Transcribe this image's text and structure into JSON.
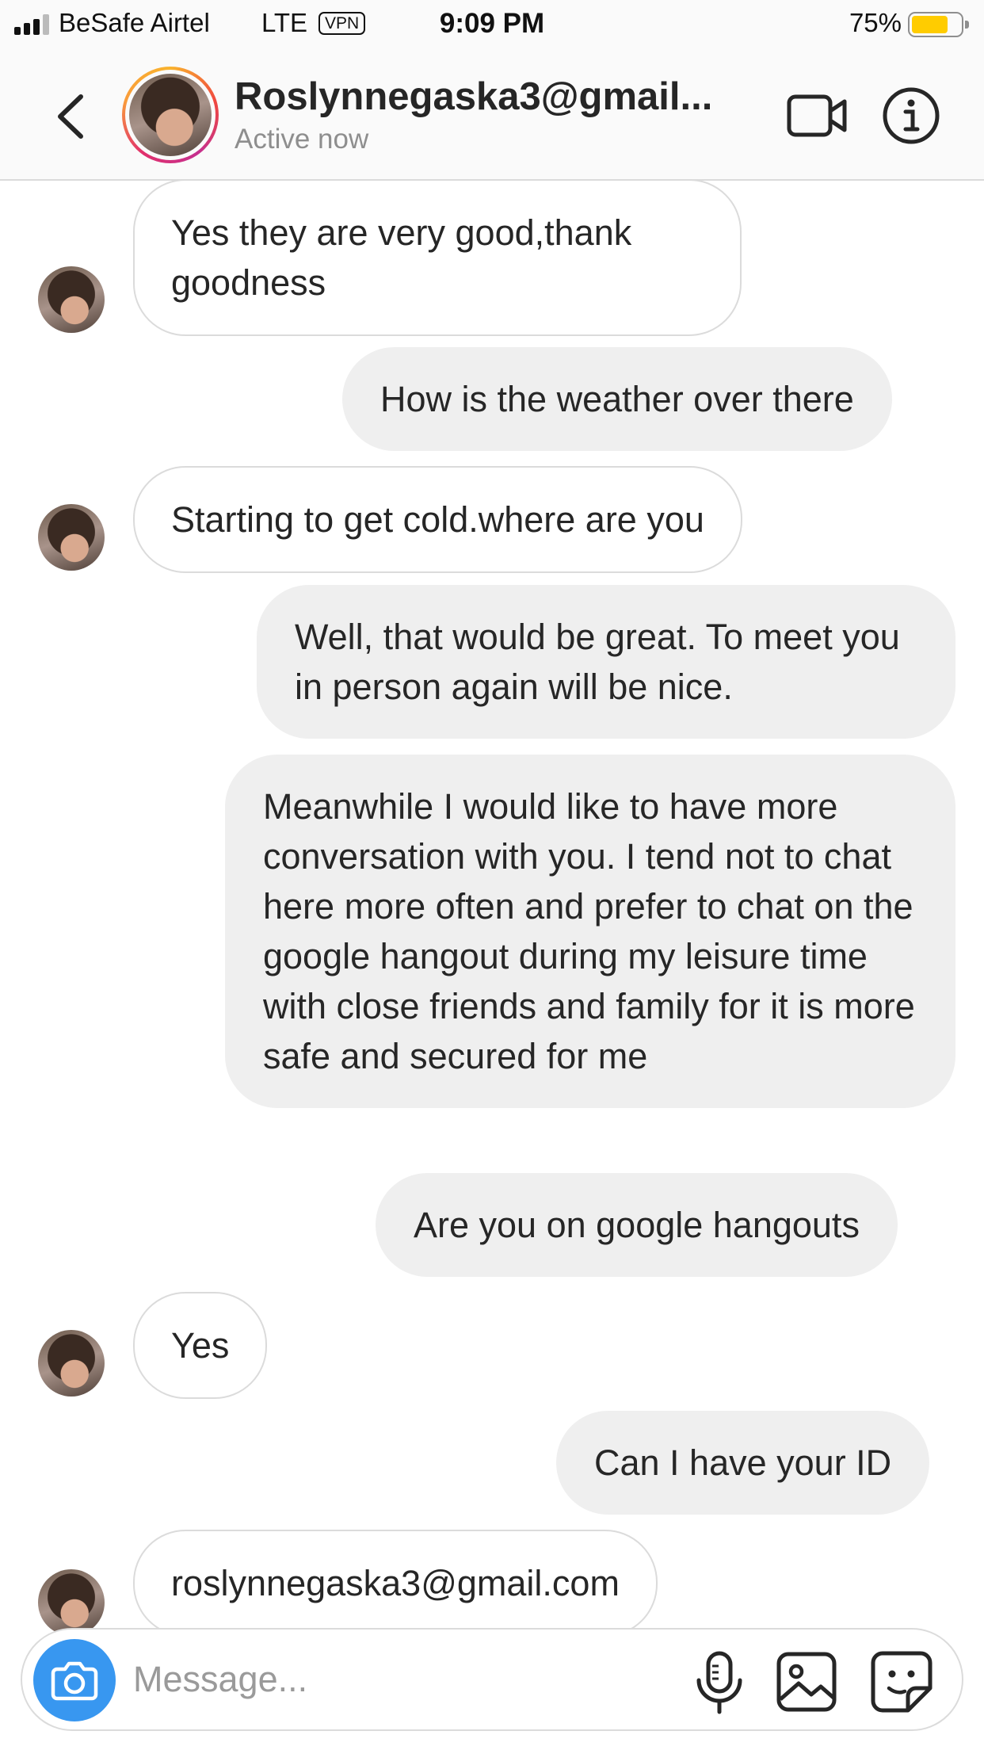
{
  "status_bar": {
    "carrier": "BeSafe Airtel",
    "network": "LTE",
    "vpn": "VPN",
    "time": "9:09 PM",
    "battery": "75%"
  },
  "header": {
    "contact_name": "Roslynnegaska3@gmail...",
    "status": "Active now",
    "icons": [
      "back-chevron-icon",
      "video-call-icon",
      "info-icon"
    ]
  },
  "messages": [
    {
      "from": "them",
      "text": "Yes they are very good,thank goodness"
    },
    {
      "from": "me",
      "text": "How is the weather over there"
    },
    {
      "from": "them",
      "text": "Starting to get cold.where are you"
    },
    {
      "from": "me",
      "text": "Well, that would be great. To meet you in person again will be nice."
    },
    {
      "from": "me",
      "text": "Meanwhile I would like to have more conversation with you. I tend not to chat here more often and prefer to chat on the google hangout during my leisure time with close friends and family for it is more safe and secured for me"
    },
    {
      "from": "me",
      "text": "Are you on google hangouts"
    },
    {
      "from": "them",
      "text": "Yes"
    },
    {
      "from": "me",
      "text": "Can I have your ID"
    },
    {
      "from": "them",
      "text": "roslynnegaska3@gmail.com"
    }
  ],
  "composer": {
    "placeholder": "Message...",
    "icons": [
      "camera-icon",
      "microphone-icon",
      "gallery-icon",
      "sticker-icon"
    ]
  },
  "colors": {
    "accent_blue": "#3897f0",
    "outgoing_bubble": "#efefef",
    "incoming_border": "#dbdbdb",
    "battery_fill": "#ffcc00",
    "secondary_text": "#8e8e8e"
  }
}
